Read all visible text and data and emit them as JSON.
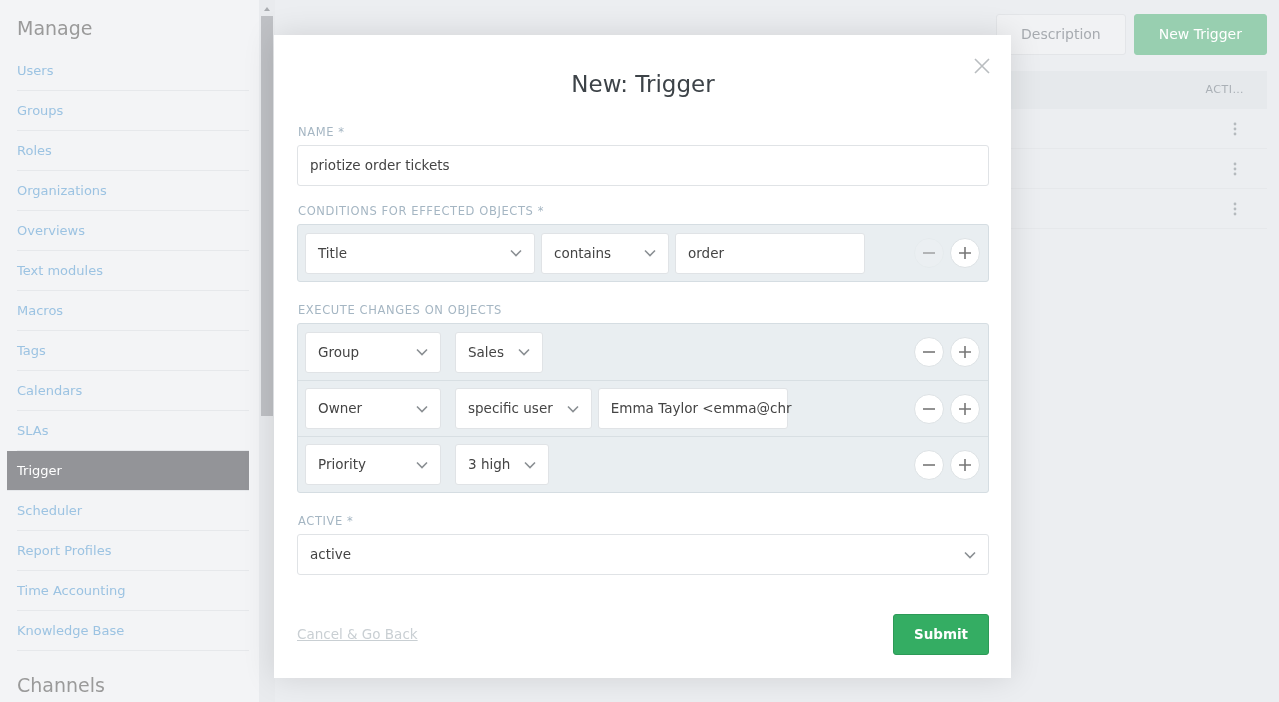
{
  "sidebar": {
    "sections": [
      {
        "title": "Manage",
        "items": [
          {
            "label": "Users",
            "selected": false
          },
          {
            "label": "Groups",
            "selected": false
          },
          {
            "label": "Roles",
            "selected": false
          },
          {
            "label": "Organizations",
            "selected": false
          },
          {
            "label": "Overviews",
            "selected": false
          },
          {
            "label": "Text modules",
            "selected": false
          },
          {
            "label": "Macros",
            "selected": false
          },
          {
            "label": "Tags",
            "selected": false
          },
          {
            "label": "Calendars",
            "selected": false
          },
          {
            "label": "SLAs",
            "selected": false
          },
          {
            "label": "Trigger",
            "selected": true
          },
          {
            "label": "Scheduler",
            "selected": false
          },
          {
            "label": "Report Profiles",
            "selected": false
          },
          {
            "label": "Time Accounting",
            "selected": false
          },
          {
            "label": "Knowledge Base",
            "selected": false
          }
        ]
      },
      {
        "title": "Channels"
      }
    ]
  },
  "page": {
    "buttons": [
      {
        "label": "Description",
        "kind": "secondary"
      },
      {
        "label": "New Trigger",
        "kind": "primary"
      }
    ],
    "table": {
      "columns": [
        {
          "label": "ACTI…"
        }
      ],
      "rows": [
        {
          "has_actions": true
        },
        {
          "has_actions": true
        },
        {
          "has_actions": true
        }
      ]
    }
  },
  "modal": {
    "title": "New: Trigger",
    "name_field": {
      "label": "NAME *",
      "value": "priotize order tickets"
    },
    "conditions": {
      "label": "CONDITIONS FOR EFFECTED OBJECTS *",
      "rows": [
        {
          "remove_disabled": true,
          "controls": [
            {
              "kind": "select",
              "value": "Title"
            },
            {
              "kind": "select",
              "value": "contains"
            },
            {
              "kind": "input",
              "value": "order"
            }
          ]
        }
      ]
    },
    "changes": {
      "label": "EXECUTE CHANGES ON OBJECTS",
      "rows": [
        {
          "remove_disabled": false,
          "controls": [
            {
              "kind": "select",
              "value": "Group"
            },
            {
              "kind": "select",
              "value": "Sales"
            }
          ]
        },
        {
          "remove_disabled": false,
          "controls": [
            {
              "kind": "select",
              "value": "Owner"
            },
            {
              "kind": "select",
              "value": "specific user"
            },
            {
              "kind": "input",
              "value": "Emma Taylor <emma@chr"
            }
          ]
        },
        {
          "remove_disabled": false,
          "controls": [
            {
              "kind": "select",
              "value": "Priority"
            },
            {
              "kind": "select",
              "value": "3 high"
            }
          ]
        }
      ]
    },
    "active_field": {
      "label": "ACTIVE *",
      "value": "active"
    },
    "cancel": "Cancel & Go Back",
    "submit": "Submit"
  }
}
